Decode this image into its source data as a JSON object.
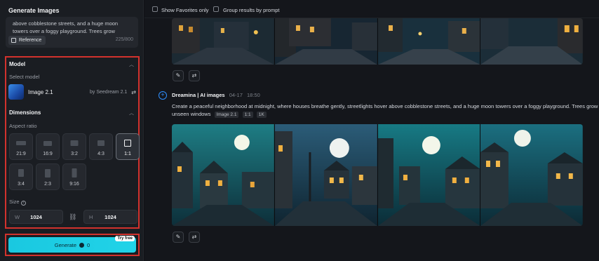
{
  "left": {
    "title": "Generate Images",
    "prompt_text": "above cobblestone streets, and a huge moon towers over a foggy playground. Trees grow",
    "reference_label": "Reference",
    "char_count": "225/800",
    "model_section": {
      "heading": "Model",
      "select_label": "Select model",
      "model_name": "Image 2.1",
      "model_by": "by Seedream 2.1"
    },
    "dimensions": {
      "heading": "Dimensions",
      "aspect_label": "Aspect ratio",
      "ratios": [
        "21:9",
        "16:9",
        "3:2",
        "4:3",
        "1:1",
        "3:4",
        "2:3",
        "9:16"
      ],
      "selected_ratio": "1:1",
      "size_label": "Size",
      "width_letter": "W",
      "width_value": "1024",
      "height_letter": "H",
      "height_value": "1024"
    },
    "generate": {
      "label": "Generate",
      "credits": "0",
      "badge": "Try free"
    }
  },
  "right": {
    "toolbar": {
      "show_favorites": "Show Favorites only",
      "group_by_prompt": "Group results by prompt"
    },
    "generation": {
      "author": "Dreamina | AI images",
      "date": "04-17",
      "time": "18:50",
      "prompt": "Create a peaceful neighborhood at midnight, where houses breathe gently, streetlights hover above cobblestone streets, and a huge moon towers over a foggy playground. Trees grow unseen windows",
      "tags": [
        "Image 2.1",
        "1:1",
        "1K"
      ]
    }
  },
  "icons": {
    "edit": "pencil-icon",
    "regenerate": "refresh-icon",
    "link": "link-icon",
    "add": "plus-circle-icon",
    "settings": "sliders-icon",
    "info": "info-icon",
    "credits": "coin-icon"
  },
  "colors": {
    "accent": "#1ac8e0",
    "highlight_border": "#d2322d",
    "brand_blue": "#2f8fff"
  }
}
